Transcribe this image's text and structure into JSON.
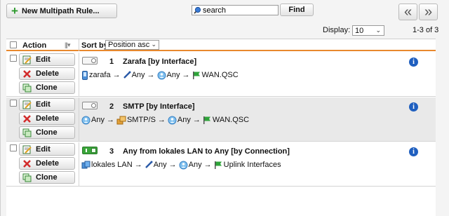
{
  "toolbar": {
    "new_rule_label": "New Multipath Rule...",
    "search_value": "search",
    "find_label": "Find",
    "prev_label": "«",
    "next_label": "»"
  },
  "pagination": {
    "display_label": "Display:",
    "display_value": "10",
    "range_text": "1-3 of 3"
  },
  "table": {
    "action_header": "Action",
    "sort_by_label": "Sort by:",
    "sort_value": "Position asc"
  },
  "actions": {
    "edit": "Edit",
    "delete": "Delete",
    "clone": "Clone"
  },
  "arrow": "→",
  "rules": [
    {
      "number": "1",
      "name": "Zarafa [by Interface]",
      "enabled": false,
      "source": "zarafa",
      "service": "Any",
      "destination": "Any",
      "gateway": "WAN.QSC"
    },
    {
      "number": "2",
      "name": "SMTP [by Interface]",
      "enabled": false,
      "source": "Any",
      "service": "SMTP/S",
      "destination": "Any",
      "gateway": "WAN.QSC"
    },
    {
      "number": "3",
      "name": "Any from lokales LAN to Any [by Connection]",
      "enabled": true,
      "source": "lokales LAN",
      "service": "Any",
      "destination": "Any",
      "gateway": "Uplink Interfaces"
    }
  ],
  "colors": {
    "header_underline": "#e8892e",
    "row_alt": "#e9e9e9",
    "info_blue": "#1f5fbf",
    "toggle_on": "#3aa53a",
    "add_green": "#2e9a2e",
    "delete_red": "#d22b2b"
  }
}
